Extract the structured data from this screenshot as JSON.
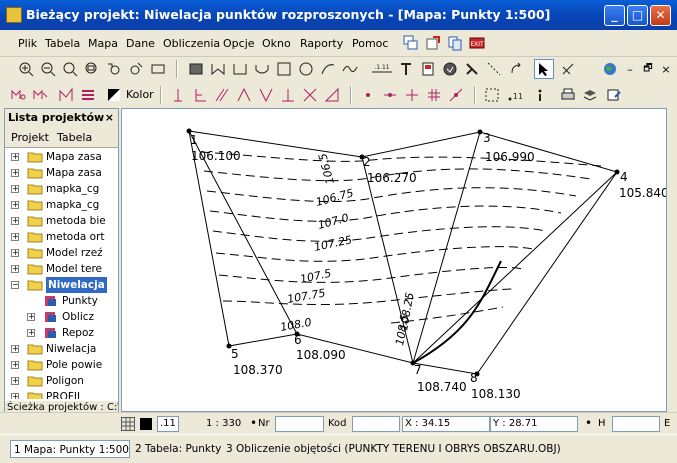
{
  "window": {
    "title": "Bieżący projekt: Niwelacja punktów rozproszonych - [Mapa: Punkty  1:500]",
    "minimize": "_",
    "maximize": "□",
    "close": "✕"
  },
  "menu": [
    "Plik",
    "Tabela",
    "Mapa",
    "Dane",
    "Obliczenia",
    "Opcje",
    "Okno",
    "Raporty",
    "Pomoc"
  ],
  "toolbar": {
    "color_label": "Kolor",
    "small_label_a": ".1.11",
    "small_label_b": "11"
  },
  "project_panel": {
    "title": "Lista projektów",
    "close": "×",
    "tabs": [
      "Projekt",
      "Tabela"
    ],
    "items": [
      {
        "label": "Mapa zasa"
      },
      {
        "label": "Mapa zasa"
      },
      {
        "label": "mapka_cg"
      },
      {
        "label": "mapka_cg"
      },
      {
        "label": "metoda bie"
      },
      {
        "label": "metoda ort"
      },
      {
        "label": "Model rzeź"
      },
      {
        "label": "Model tere"
      },
      {
        "label": "Niwelacja",
        "selected": true
      },
      {
        "label": "Punkty"
      },
      {
        "label": "Oblicz"
      },
      {
        "label": "Repoz"
      },
      {
        "label": "Niwelacja"
      },
      {
        "label": "Pole powie"
      },
      {
        "label": "Poligon"
      },
      {
        "label": "PROFIL"
      }
    ],
    "footer": "Ścieżka projektów : C:\\"
  },
  "map": {
    "points": [
      {
        "id": "1",
        "height": "106.100"
      },
      {
        "id": "2",
        "height": "106.270"
      },
      {
        "id": "3",
        "height": "106.990"
      },
      {
        "id": "4",
        "height": "105.840"
      },
      {
        "id": "5",
        "height": "108.370"
      },
      {
        "id": "6",
        "height": "108.090"
      },
      {
        "id": "7",
        "height": "108.740"
      },
      {
        "id": "8",
        "height": "108.130"
      }
    ],
    "contour_labels": [
      "106.5",
      "106.75",
      "107.0",
      "107.25",
      "107.5",
      "107.75",
      "108.0",
      "108.25",
      "108.5"
    ]
  },
  "status": {
    "scale": "1 : 330",
    "nr_label": "Nr",
    "nr_value": "",
    "kod_label": "Kod",
    "kod_value": "",
    "x": "X : 34.15",
    "y": "Y : 28.71",
    "h_label": "H",
    "e_label": "E",
    "tick_label": ".11"
  },
  "tasks": [
    {
      "label": "1 Mapa: Punkty  1:500",
      "active": true
    },
    {
      "label": "2 Tabela: Punkty",
      "active": false
    },
    {
      "label": "3 Obliczenie objętości (PUNKTY TERENU I OBRYS OBSZARU.OBJ)",
      "active": false
    }
  ]
}
